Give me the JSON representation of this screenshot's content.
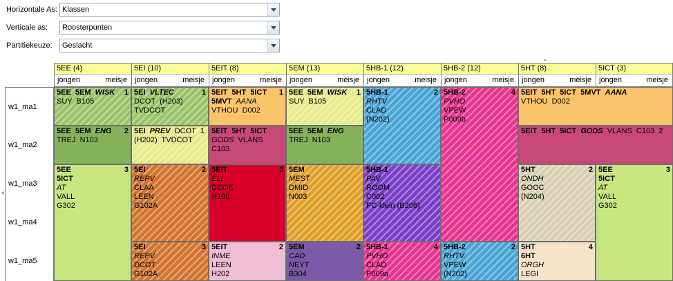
{
  "controls": {
    "horizontal": {
      "label": "Horizontale As:",
      "value": "Klassen"
    },
    "vertical": {
      "label": "Verticale as:",
      "value": "Roosterpunten"
    },
    "partition": {
      "label": "Partitiekeuze:",
      "value": "Geslacht"
    }
  },
  "columns": [
    {
      "name": "5EE (4)",
      "sub_left": "jongen",
      "sub_right": "meisje"
    },
    {
      "name": "5EI (10)",
      "sub_left": "jongen",
      "sub_right": "meisje"
    },
    {
      "name": "5EIT (8)",
      "sub_left": "jongen",
      "sub_right": "meisje"
    },
    {
      "name": "5EM (13)",
      "sub_left": "jongen",
      "sub_right": "meisje"
    },
    {
      "name": "5HB-1 (12)",
      "sub_left": "jongen",
      "sub_right": "meisje"
    },
    {
      "name": "5HB-2 (12)",
      "sub_left": "jongen",
      "sub_right": "meisje"
    },
    {
      "name": "5HT (8)",
      "sub_left": "jongen",
      "sub_right": "meisje"
    },
    {
      "name": "5ICT (3)",
      "sub_left": "jongen",
      "sub_right": "meisje"
    }
  ],
  "rows": [
    "w1_ma1",
    "w1_ma2",
    "w1_ma3",
    "w1_ma4",
    "w1_ma5"
  ],
  "lessons": [
    {
      "color": "#9ac46a",
      "hatch": true,
      "num": "1",
      "l1": "5EE  5EM  ",
      "l1i": "WISK",
      "lines": [
        [
          "SUY  B105",
          false
        ]
      ]
    },
    {
      "color": "#9ac46a",
      "hatch": true,
      "num": "1",
      "l1": "5EI  ",
      "l1i": "VLTEC",
      "lines": [
        [
          "DCOT  (H203)",
          false
        ],
        [
          "TVDCOT",
          false
        ]
      ]
    },
    {
      "color": "#fbc46a",
      "hatch": false,
      "num": "1",
      "l1": "5EIT  5HT  5ICT",
      "l1i": "",
      "lines": [
        [
          "5MVT  ",
          "AANA",
          true
        ],
        [
          "VTHOU  D002",
          false
        ]
      ]
    },
    {
      "color": "#e5ea8a",
      "hatch": true,
      "num": "1",
      "l1": "5EE  5EM  ",
      "l1i": "WISK",
      "lines": [
        [
          "SUY  B105",
          false
        ]
      ]
    },
    {
      "color": "#4aa6d6",
      "hatch": true,
      "num": "2",
      "l1": "5HB-1",
      "l1i": "",
      "lines": [
        [
          "RHTV",
          true
        ],
        [
          "CLAD",
          false
        ],
        [
          "(N202)",
          false
        ]
      ]
    },
    {
      "color": "#e8338f",
      "hatch": true,
      "num": "4",
      "l1": "5HB-2",
      "l1i": "",
      "lines": [
        [
          "PVHO",
          true
        ],
        [
          "VPEW",
          false
        ],
        [
          "P009b",
          false
        ]
      ]
    },
    {
      "color": "#fbc46a",
      "hatch": false,
      "num": "",
      "l1": "5EIT  5HT  5ICT  5MVT  ",
      "l1i": "AANA",
      "lines": [
        [
          "VTHOU  D002",
          false
        ]
      ]
    },
    {
      "color": "#85b35c",
      "hatch": false,
      "num": "2",
      "l1": "5EE  5EM  ",
      "l1i": "ENG",
      "lines": [
        [
          "TREJ  N103",
          false
        ]
      ]
    },
    {
      "color": "#e5ea8a",
      "hatch": true,
      "num": "",
      "l1": "5EI  ",
      "l1i": "PREV",
      "l1tail": "  DCOT  1",
      "lines": [
        [
          "(H202)  TVDCOT",
          false
        ]
      ]
    },
    {
      "color": "#c84877",
      "hatch": false,
      "num": "",
      "l1": "5EIT  5HT  5ICT",
      "l1i": "",
      "lines": [
        [
          "GODS",
          "  VLANS",
          true
        ],
        [
          "C103",
          false
        ]
      ]
    },
    {
      "color": "#85b35c",
      "hatch": false,
      "num": "",
      "l1": "5EE  5EM  ",
      "l1i": "ENG",
      "lines": [
        [
          "TREJ  N103",
          false
        ]
      ]
    },
    {
      "color": "#c84877",
      "hatch": false,
      "num": "",
      "l1": "5EIT  5HT  5ICT  ",
      "l1i": "GODS",
      "l1tail": "  VLANS  C103  2",
      "lines": []
    },
    {
      "color": "#c8e680",
      "hatch": false,
      "num": "3",
      "l1": "5EE",
      "l1i": "",
      "lines": [
        [
          "5ICT",
          false,
          "bold"
        ],
        [
          "AT",
          true
        ],
        [
          "VALL",
          false
        ],
        [
          "G302",
          false
        ]
      ]
    },
    {
      "color": "#d2742e",
      "hatch": true,
      "num": "2",
      "l1": "5EI",
      "l1i": "",
      "lines": [
        [
          "REPV",
          true
        ],
        [
          "CLAA",
          false
        ],
        [
          "LEEN",
          false
        ],
        [
          "G102A",
          false
        ]
      ]
    },
    {
      "color": "#d8002a",
      "hatch": false,
      "num": "3",
      "l1": "5EIT",
      "l1i": "",
      "lines": [
        [
          "ELI",
          true
        ],
        [
          "DCOE",
          false
        ],
        [
          "H106",
          false
        ]
      ]
    },
    {
      "color": "#e0a028",
      "hatch": true,
      "num": "",
      "l1": "5EM",
      "l1i": "",
      "lines": [
        [
          "MEST",
          true
        ],
        [
          "DMID",
          false
        ],
        [
          "N003",
          false
        ]
      ]
    },
    {
      "color": "#7a3ec8",
      "hatch": true,
      "num": "",
      "l1": "5HB-1",
      "l1i": "",
      "lines": [
        [
          "PAV",
          true
        ],
        [
          "ROOM",
          false
        ],
        [
          "C002",
          false
        ],
        [
          "PC-klein (B206)",
          false
        ]
      ]
    },
    {
      "color": "#d7d0b0",
      "hatch": true,
      "num": "2",
      "l1": "5HT",
      "l1i": "",
      "lines": [
        [
          "ONDH",
          true
        ],
        [
          "GOOC",
          false
        ],
        [
          "(N204)",
          false
        ]
      ]
    },
    {
      "color": "#c8e680",
      "hatch": false,
      "num": "3",
      "l1": "5EE",
      "l1i": "",
      "lines": [
        [
          "5ICT",
          false,
          "bold"
        ],
        [
          "AT",
          true
        ],
        [
          "VALL",
          false
        ],
        [
          "G302",
          false
        ]
      ]
    },
    {
      "color": "#d2742e",
      "hatch": true,
      "num": "3",
      "l1": "5EI",
      "l1i": "",
      "lines": [
        [
          "REPV",
          true
        ],
        [
          "DCOT",
          false
        ],
        [
          "G102A",
          false
        ]
      ]
    },
    {
      "color": "#efbdd4",
      "hatch": false,
      "num": "2",
      "l1": "5EIT",
      "l1i": "",
      "lines": [
        [
          "INME",
          true
        ],
        [
          "LEEN",
          false
        ],
        [
          "H202",
          false
        ]
      ]
    },
    {
      "color": "#7a5aa8",
      "hatch": false,
      "num": "2",
      "l1": "5EM",
      "l1i": "",
      "lines": [
        [
          "CAD",
          true
        ],
        [
          "NEYT",
          false
        ],
        [
          "B304",
          false
        ]
      ]
    },
    {
      "color": "#e8338f",
      "hatch": true,
      "num": "4",
      "l1": "5HB-1",
      "l1i": "",
      "lines": [
        [
          "PVHO",
          true
        ],
        [
          "CLAD",
          false
        ],
        [
          "P009a",
          false
        ]
      ]
    },
    {
      "color": "#4aa6d6",
      "hatch": true,
      "num": "2",
      "l1": "5HB-2",
      "l1i": "",
      "lines": [
        [
          "RHTV",
          true
        ],
        [
          "VPEW",
          false
        ],
        [
          "(N202)",
          false
        ]
      ]
    },
    {
      "color": "#f6e3c8",
      "hatch": false,
      "num": "4",
      "l1": "5HT",
      "l1i": "",
      "lines": [
        [
          "6HT",
          false,
          "bold"
        ],
        [
          "ORGH",
          true
        ],
        [
          "LEGI",
          false
        ]
      ]
    }
  ]
}
